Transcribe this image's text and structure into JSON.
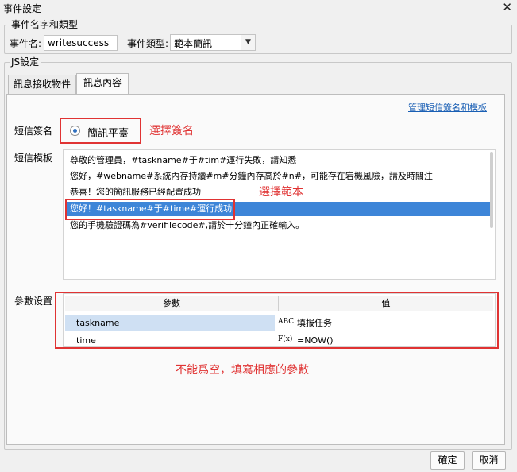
{
  "window": {
    "title": "事件設定",
    "close_glyph": "✕"
  },
  "event_group": {
    "legend": "事件名字和類型",
    "name_label": "事件名:",
    "name_value": "writesuccess",
    "type_label": "事件類型:",
    "type_value": "範本簡訊"
  },
  "js_group": {
    "legend": "JS設定"
  },
  "tabs": [
    {
      "label": "訊息接收物件"
    },
    {
      "label": "訊息內容"
    }
  ],
  "content": {
    "manage_link": "管理短信簽名和模板",
    "signature_label": "短信簽名",
    "signature_value": "簡訊平臺",
    "template_label": "短信模板",
    "templates": [
      "尊敬的管理員，#taskname#于#tim#運行失敗，請知悉",
      "您好，#webname#系統內存持續#m#分鐘內存高於#n#，可能存在宕機風險，請及時關注",
      "恭喜！您的簡訊服務已經配置成功",
      "您好！#taskname#于#time#運行成功",
      "您的手機驗證碼為#verifilecode#,請於十分鐘內正確輸入。"
    ],
    "params_label": "參數设置",
    "params_header": {
      "param": "參數",
      "value": "值"
    },
    "params": [
      {
        "name": "taskname",
        "icon_text": "ABC",
        "value": "填报任务"
      },
      {
        "name": "time",
        "icon_text": "F(x)",
        "value": "=NOW()"
      }
    ]
  },
  "annotations": {
    "select_signature": "選擇簽名",
    "select_template": "選擇範本",
    "param_note": "不能爲空，填寫相應的參數",
    "color": "#e03333"
  },
  "buttons": {
    "ok": "確定",
    "cancel": "取消"
  }
}
